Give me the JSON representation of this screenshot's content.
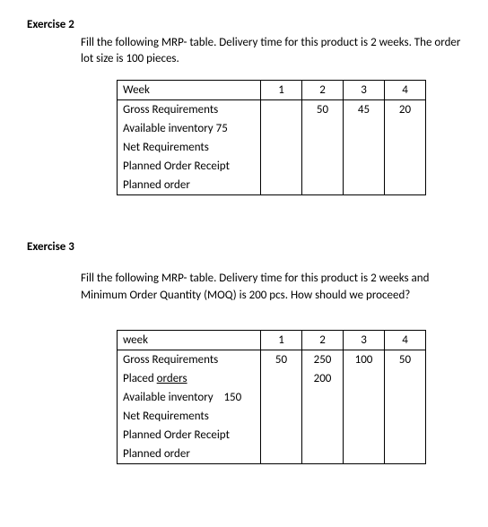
{
  "ex2": {
    "title": "Exercise 2",
    "instruction": "Fill the following MRP- table. Delivery time for this product is 2 weeks. The order lot size is 100 pieces.",
    "rows": {
      "week_label": "Week",
      "gross": "Gross Requirements",
      "avail": "Available inventory 75",
      "net": "Net Requirements",
      "por": "Planned Order Receipt",
      "po": "Planned order"
    },
    "weeks": [
      "1",
      "2",
      "3",
      "4"
    ],
    "gross_vals": [
      "",
      "50",
      "45",
      "20"
    ]
  },
  "ex3": {
    "title": "Exercise 3",
    "instruction": "Fill the following MRP- table. Delivery time for this product is 2 weeks and Minimum Order Quantity (MOQ) is 200 pcs. How should we proceed?",
    "rows": {
      "week_label": "week",
      "gross": "Gross Requirements",
      "placed_pre": "Placed ",
      "placed_u": "orders",
      "avail_pre": "Available inventory",
      "avail_num": "150",
      "net": "Net Requirements",
      "por": "Planned Order Receipt",
      "po": "Planned order"
    },
    "weeks": [
      "1",
      "2",
      "3",
      "4"
    ],
    "gross_vals": [
      "50",
      "250",
      "100",
      "50"
    ],
    "placed_vals": [
      "",
      "200",
      "",
      ""
    ]
  }
}
